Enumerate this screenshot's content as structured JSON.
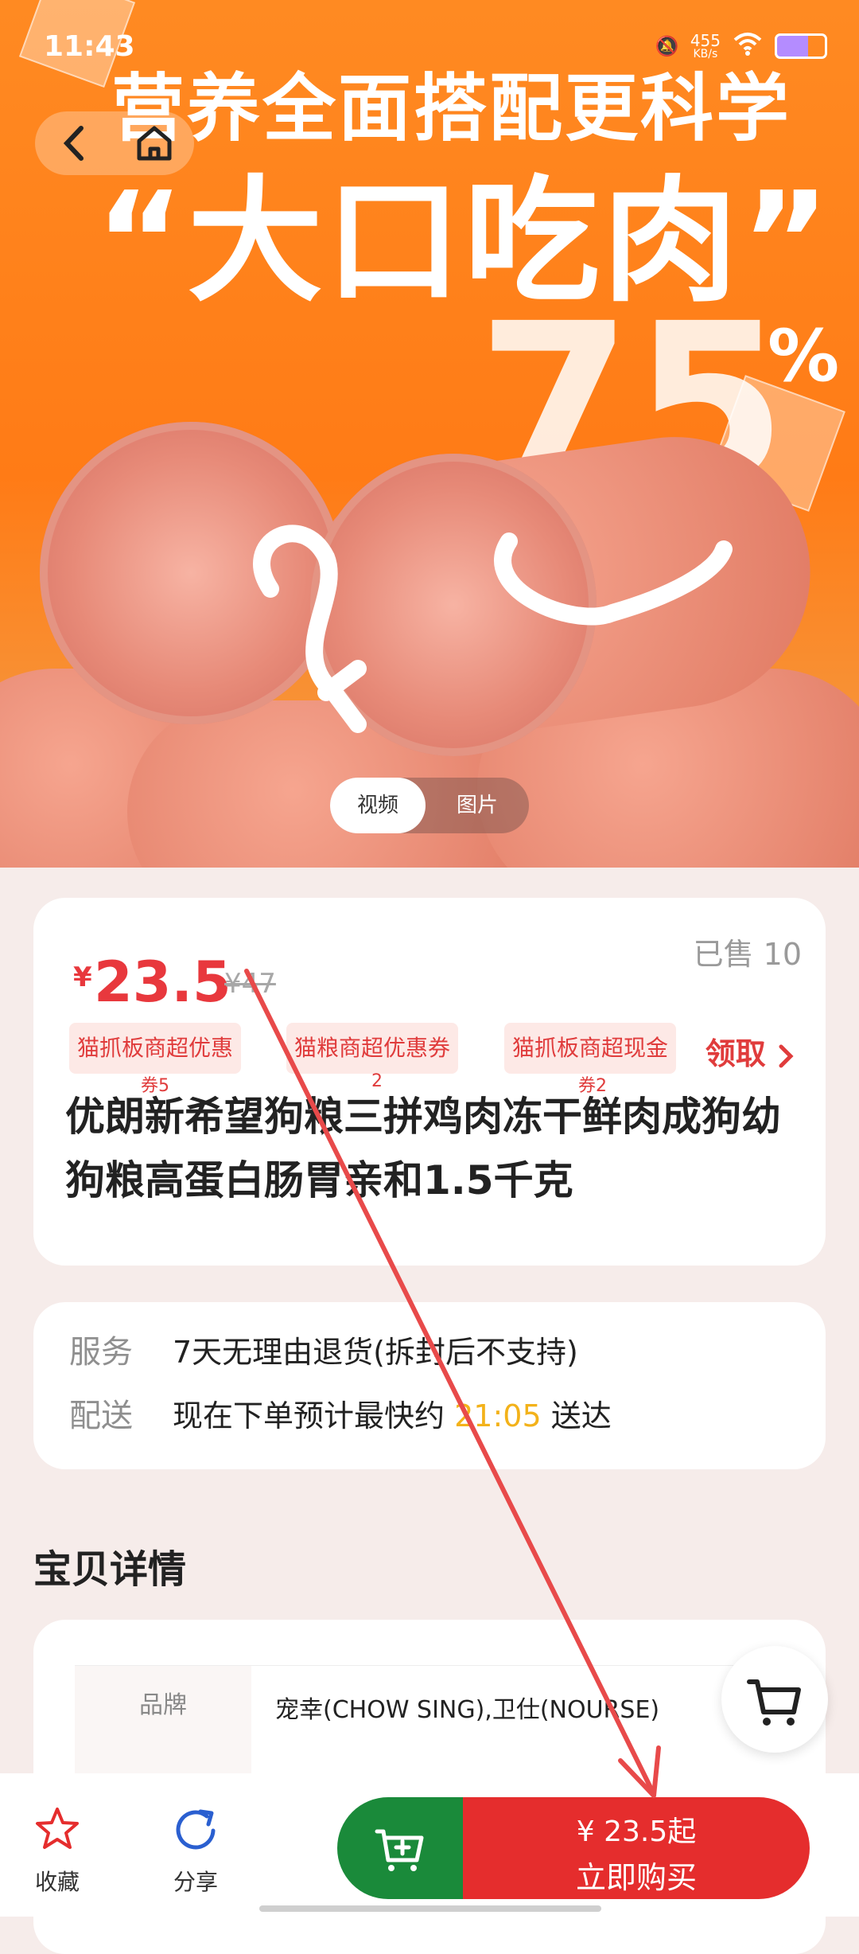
{
  "status_bar": {
    "time": "11:43",
    "net_speed": "455",
    "net_unit": "KB/s"
  },
  "hero": {
    "headline1": "营养全面搭配更科学",
    "headline2": "“大口吃肉”",
    "percent_number": "75",
    "percent_sign": "%"
  },
  "media_tabs": [
    "视频",
    "图片"
  ],
  "price_card": {
    "currency": "¥",
    "price": "23.5",
    "original_price": "¥47",
    "sold": "已售 10",
    "coupons": [
      {
        "label": "猫抓板商超优惠",
        "sub": "券5"
      },
      {
        "label": "猫粮商超优惠券",
        "sub": "2"
      },
      {
        "label": "猫抓板商超现金",
        "sub": "券2"
      }
    ],
    "claim": "领取",
    "title": "优朗新希望狗粮三拼鸡肉冻干鲜肉成狗幼狗粮高蛋白肠胃亲和1.5千克"
  },
  "service": {
    "service_label": "服务",
    "service_value": "7天无理由退货(拆封后不支持)",
    "delivery_label": "配送",
    "delivery_prefix": "现在下单预计最快约",
    "delivery_time": "21:05",
    "delivery_suffix": "送达"
  },
  "details": {
    "heading": "宝贝详情",
    "attrs": [
      {
        "key": "品牌",
        "value": "宠幸(CHOW SING),卫仕(NOURSE)"
      }
    ]
  },
  "bottom_bar": {
    "favorite": "收藏",
    "share": "分享",
    "buy_price": "¥ 23.5起",
    "buy_label": "立即购买"
  },
  "colors": {
    "accent_red": "#e52d2d",
    "cart_green": "#1a8a3a",
    "price_red": "#e8383d",
    "hero_orange": "#ff7b16",
    "time_yellow": "#f3b21a"
  }
}
